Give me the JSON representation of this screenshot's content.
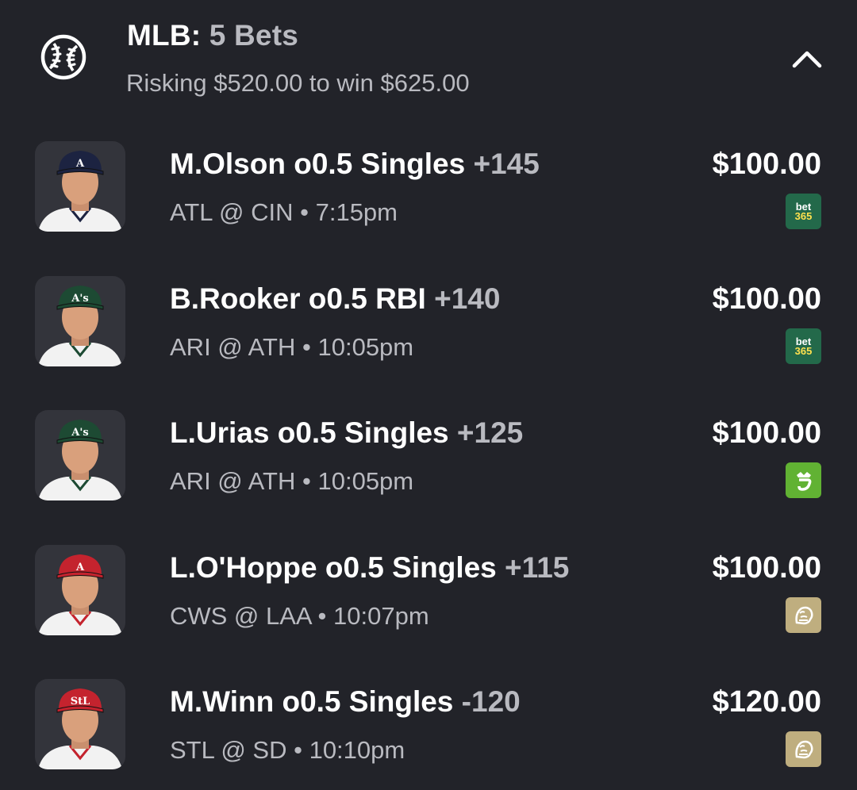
{
  "header": {
    "sport_icon": "baseball-icon",
    "league": "MLB:",
    "count_label": "5 Bets",
    "summary": "Risking $520.00 to win $625.00",
    "collapse_icon": "chevron-up-icon"
  },
  "colors": {
    "background": "#222329",
    "muted_text": "#b9bac0",
    "bet365": "#23694a",
    "draftkings": "#61b233",
    "betmgm": "#bfae7f"
  },
  "bets": [
    {
      "player": "M.Olson",
      "market": "o0.5 Singles",
      "odds": "+145",
      "matchup": "ATL @ CIN",
      "time": "7:15pm",
      "stake": "$100.00",
      "book": "bet365",
      "book_text": [
        "bet",
        "365"
      ],
      "cap_color": "#1c2341",
      "cap_logo": "A"
    },
    {
      "player": "B.Rooker",
      "market": "o0.5 RBI",
      "odds": "+140",
      "matchup": "ARI @ ATH",
      "time": "10:05pm",
      "stake": "$100.00",
      "book": "bet365",
      "book_text": [
        "bet",
        "365"
      ],
      "cap_color": "#1d4a33",
      "cap_logo": "A's"
    },
    {
      "player": "L.Urias",
      "market": "o0.5 Singles",
      "odds": "+125",
      "matchup": "ARI @ ATH",
      "time": "10:05pm",
      "stake": "$100.00",
      "book": "draftkings",
      "cap_color": "#1d4a33",
      "cap_logo": "A's"
    },
    {
      "player": "L.O'Hoppe",
      "market": "o0.5 Singles",
      "odds": "+115",
      "matchup": "CWS @ LAA",
      "time": "10:07pm",
      "stake": "$100.00",
      "book": "betmgm",
      "cap_color": "#c4232e",
      "cap_logo": "A"
    },
    {
      "player": "M.Winn",
      "market": "o0.5 Singles",
      "odds": "-120",
      "matchup": "STL @ SD",
      "time": "10:10pm",
      "stake": "$120.00",
      "book": "betmgm",
      "cap_color": "#c4232e",
      "cap_logo": "StL"
    }
  ],
  "separator": "•"
}
